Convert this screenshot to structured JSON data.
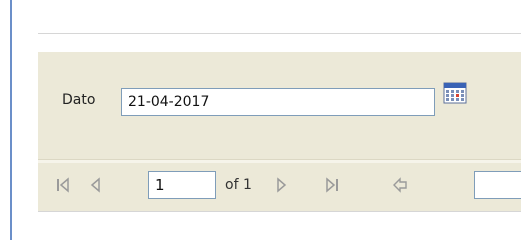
{
  "parameters": {
    "date_label": "Dato",
    "date_value": "21-04-2017",
    "calendar_icon": "calendar-icon"
  },
  "toolbar": {
    "current_page": "1",
    "page_of": "of 1",
    "first_icon": "first-page-icon",
    "prev_icon": "previous-page-icon",
    "next_icon": "next-page-icon",
    "last_icon": "last-page-icon",
    "back_icon": "back-icon",
    "search_value": ""
  },
  "colors": {
    "panel_bg": "#ece9d8",
    "frame_border": "#6b8fc9",
    "input_border": "#7f9db9",
    "icon_gray": "#9a9a9a"
  }
}
